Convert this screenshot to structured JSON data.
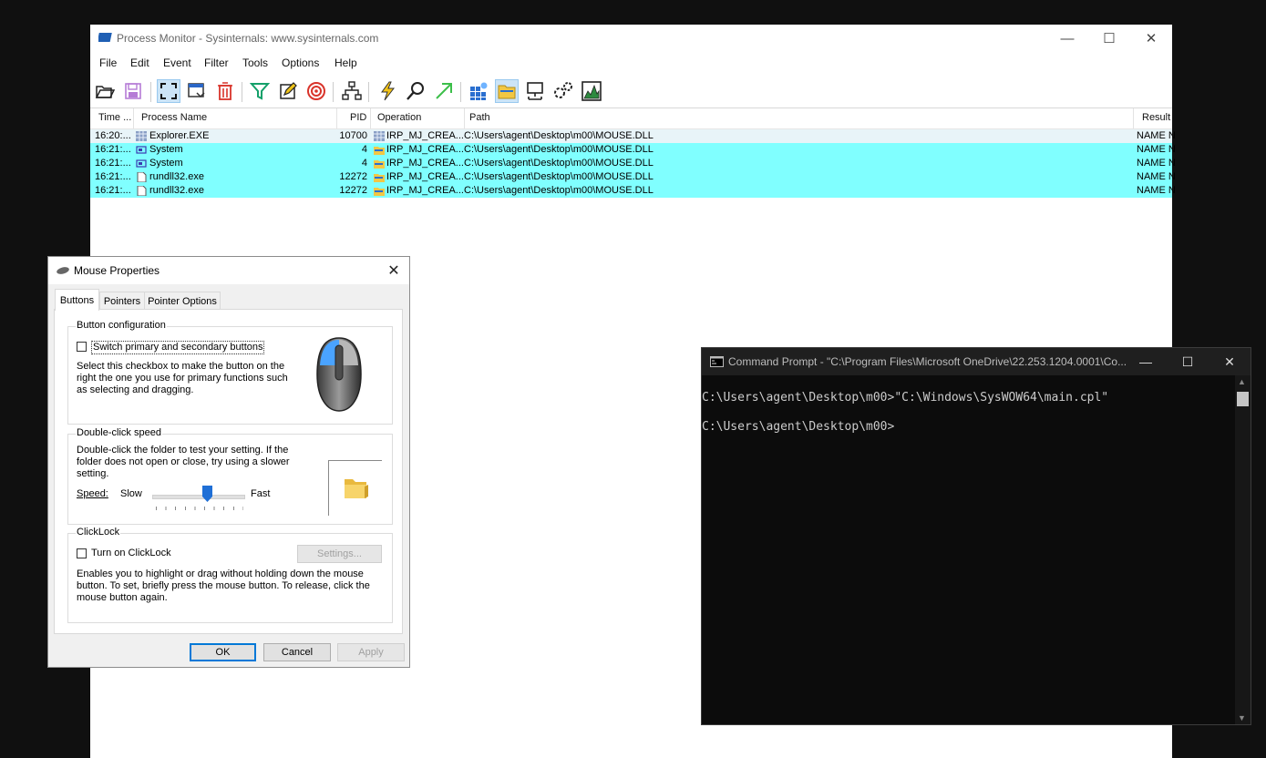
{
  "procmon": {
    "title": "Process Monitor - Sysinternals: www.sysinternals.com",
    "menu": [
      "File",
      "Edit",
      "Event",
      "Filter",
      "Tools",
      "Options",
      "Help"
    ],
    "columns": [
      "Time ...",
      "Process Name",
      "PID",
      "Operation",
      "Path",
      "Result"
    ],
    "rows": [
      {
        "time": "16:20:...",
        "process": "Explorer.EXE",
        "pid": "10700",
        "operation": "IRP_MJ_CREA...",
        "path": "C:\\Users\\agent\\Desktop\\m00\\MOUSE.DLL",
        "result": "NAME N"
      },
      {
        "time": "16:21:...",
        "process": "System",
        "pid": "4",
        "operation": "IRP_MJ_CREA...",
        "path": "C:\\Users\\agent\\Desktop\\m00\\MOUSE.DLL",
        "result": "NAME N"
      },
      {
        "time": "16:21:...",
        "process": "System",
        "pid": "4",
        "operation": "IRP_MJ_CREA...",
        "path": "C:\\Users\\agent\\Desktop\\m00\\MOUSE.DLL",
        "result": "NAME N"
      },
      {
        "time": "16:21:...",
        "process": "rundll32.exe",
        "pid": "12272",
        "operation": "IRP_MJ_CREA...",
        "path": "C:\\Users\\agent\\Desktop\\m00\\MOUSE.DLL",
        "result": "NAME N"
      },
      {
        "time": "16:21:...",
        "process": "rundll32.exe",
        "pid": "12272",
        "operation": "IRP_MJ_CREA...",
        "path": "C:\\Users\\agent\\Desktop\\m00\\MOUSE.DLL",
        "result": "NAME N"
      }
    ],
    "highlight_color": "#80ffff"
  },
  "mouse": {
    "title": "Mouse Properties",
    "tabs": [
      "Buttons",
      "Pointers",
      "Pointer Options"
    ],
    "button_config": {
      "title": "Button configuration",
      "checkbox_label": "Switch primary and secondary buttons",
      "checked": false,
      "desc": "Select this checkbox to make the button on the right the one you use for primary functions such as selecting and dragging."
    },
    "double_click": {
      "title": "Double-click speed",
      "desc": "Double-click the folder to test your setting. If the folder does not open or close, try using a slower setting.",
      "speed_label": "Speed:",
      "slow": "Slow",
      "fast": "Fast",
      "speed_value": 0.6
    },
    "clicklock": {
      "title": "ClickLock",
      "checkbox_label": "Turn on ClickLock",
      "checked": false,
      "settings_label": "Settings...",
      "desc": "Enables you to highlight or drag without holding down the mouse button. To set, briefly press the mouse button. To release, click the mouse button again."
    },
    "ok": "OK",
    "cancel": "Cancel",
    "apply": "Apply"
  },
  "cmd": {
    "title": "Command Prompt - \"C:\\Program Files\\Microsoft OneDrive\\22.253.1204.0001\\Co...",
    "lines": [
      "C:\\Users\\agent\\Desktop\\m00>\"C:\\Windows\\SysWOW64\\main.cpl\"",
      "",
      "C:\\Users\\agent\\Desktop\\m00>"
    ]
  }
}
